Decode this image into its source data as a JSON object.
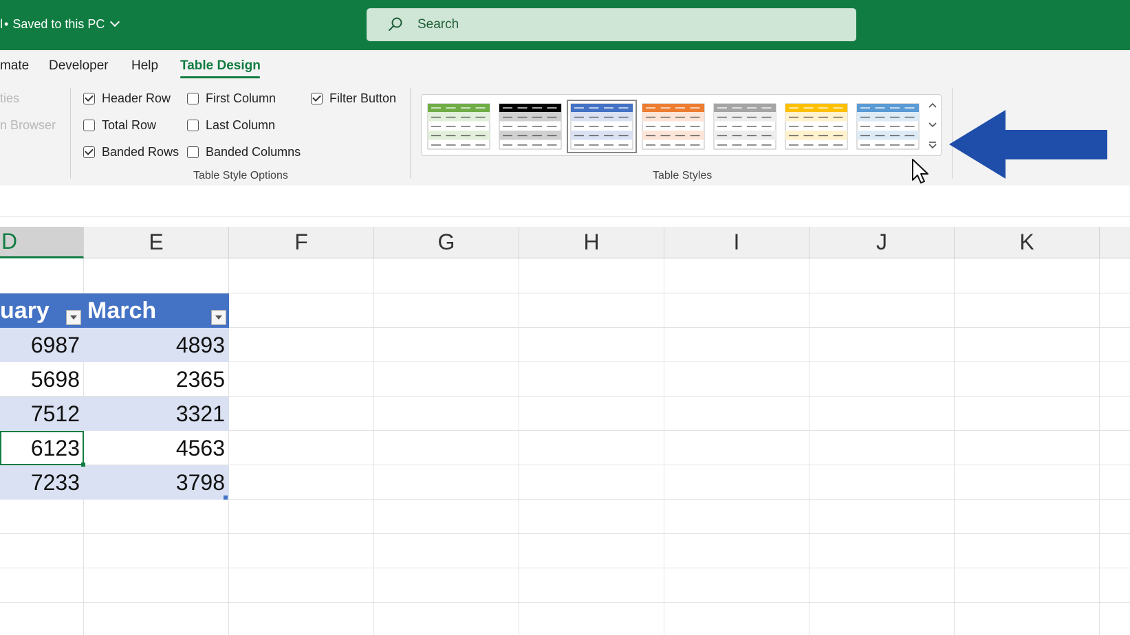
{
  "titlebar": {
    "truncated_prefix": "l",
    "save_status": "Saved to this PC",
    "search_placeholder": "Search"
  },
  "tabs": [
    {
      "label": "mate"
    },
    {
      "label": "Developer"
    },
    {
      "label": "Help"
    },
    {
      "label": "Table Design",
      "active": true
    }
  ],
  "ribbon": {
    "ghost_items": [
      "ties",
      "n Browser"
    ],
    "options": {
      "header_row": {
        "label": "Header Row",
        "checked": true
      },
      "total_row": {
        "label": "Total Row",
        "checked": false
      },
      "banded_rows": {
        "label": "Banded Rows",
        "checked": true
      },
      "first_column": {
        "label": "First Column",
        "checked": false
      },
      "last_column": {
        "label": "Last Column",
        "checked": false
      },
      "banded_columns": {
        "label": "Banded Columns",
        "checked": false
      },
      "filter_button": {
        "label": "Filter Button",
        "checked": true
      }
    },
    "group_style_options": "Table Style Options",
    "group_table_styles": "Table Styles",
    "styles": [
      {
        "name": "green",
        "color": "#70ad47",
        "band": "#e2efda"
      },
      {
        "name": "black",
        "color": "#000000",
        "band": "#d0d0d0"
      },
      {
        "name": "blue",
        "color": "#4472c4",
        "band": "#d9e1f2",
        "selected": true
      },
      {
        "name": "orange",
        "color": "#ed7d31",
        "band": "#fce4d6"
      },
      {
        "name": "gray",
        "color": "#a5a5a5",
        "band": "#ededed"
      },
      {
        "name": "gold",
        "color": "#ffc000",
        "band": "#fff2cc"
      },
      {
        "name": "lightblue",
        "color": "#5b9bd5",
        "band": "#ddebf7"
      }
    ],
    "annotation_arrow_color": "#1f4eaa"
  },
  "sheet": {
    "columns": [
      "D",
      "E",
      "F",
      "G",
      "H",
      "I",
      "J",
      "K"
    ],
    "active_column": "D",
    "table": {
      "headers": [
        "uary",
        "March"
      ],
      "rows": [
        [
          "6987",
          "4893"
        ],
        [
          "5698",
          "2365"
        ],
        [
          "7512",
          "3321"
        ],
        [
          "6123",
          "4563"
        ],
        [
          "7233",
          "3798"
        ]
      ]
    },
    "table_header_color": "#4472c4",
    "table_band_color": "#d9e1f2"
  }
}
